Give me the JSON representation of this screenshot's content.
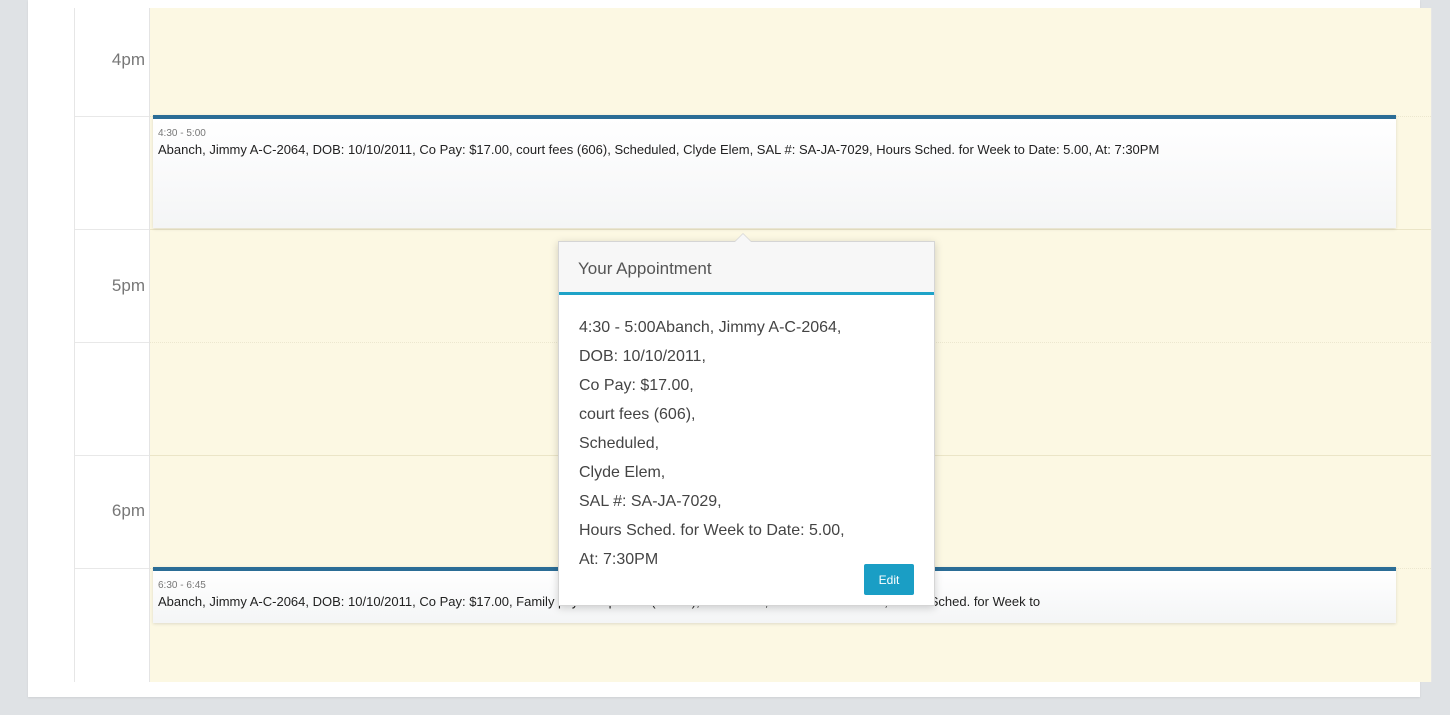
{
  "calendar": {
    "hours": [
      "4pm",
      "5pm",
      "6pm"
    ],
    "events": [
      {
        "time": "4:30 - 5:00",
        "title": "Abanch, Jimmy A-C-2064, DOB: 10/10/2011, Co Pay: $17.00, court fees (606), Scheduled, Clyde Elem, SAL #: SA-JA-7029, Hours Sched. for Week to Date: 5.00, At: 7:30PM"
      },
      {
        "time": "6:30 - 6:45",
        "title": "Abanch, Jimmy A-C-2064, DOB: 10/10/2011, Co Pay: $17.00, Family psych w/patient (90847), Scheduled, SAL #: SA-JA-7027, Hours Sched. for Week to"
      }
    ]
  },
  "popover": {
    "title": "Your Appointment",
    "lines": [
      "4:30 - 5:00Abanch, Jimmy A-C-2064,",
      "DOB: 10/10/2011,",
      "Co Pay: $17.00,",
      "court fees (606),",
      "Scheduled,",
      "Clyde Elem,",
      "SAL #: SA-JA-7029,",
      "Hours Sched. for Week to Date: 5.00,",
      "At:  7:30PM"
    ],
    "edit_label": "Edit"
  },
  "colors": {
    "page_background": "#dfe2e5",
    "day_column": "#fcf8e3",
    "event_border": "#2b6d96",
    "popover_accent": "#1fa3c8",
    "edit_button": "#1a9ec5"
  }
}
